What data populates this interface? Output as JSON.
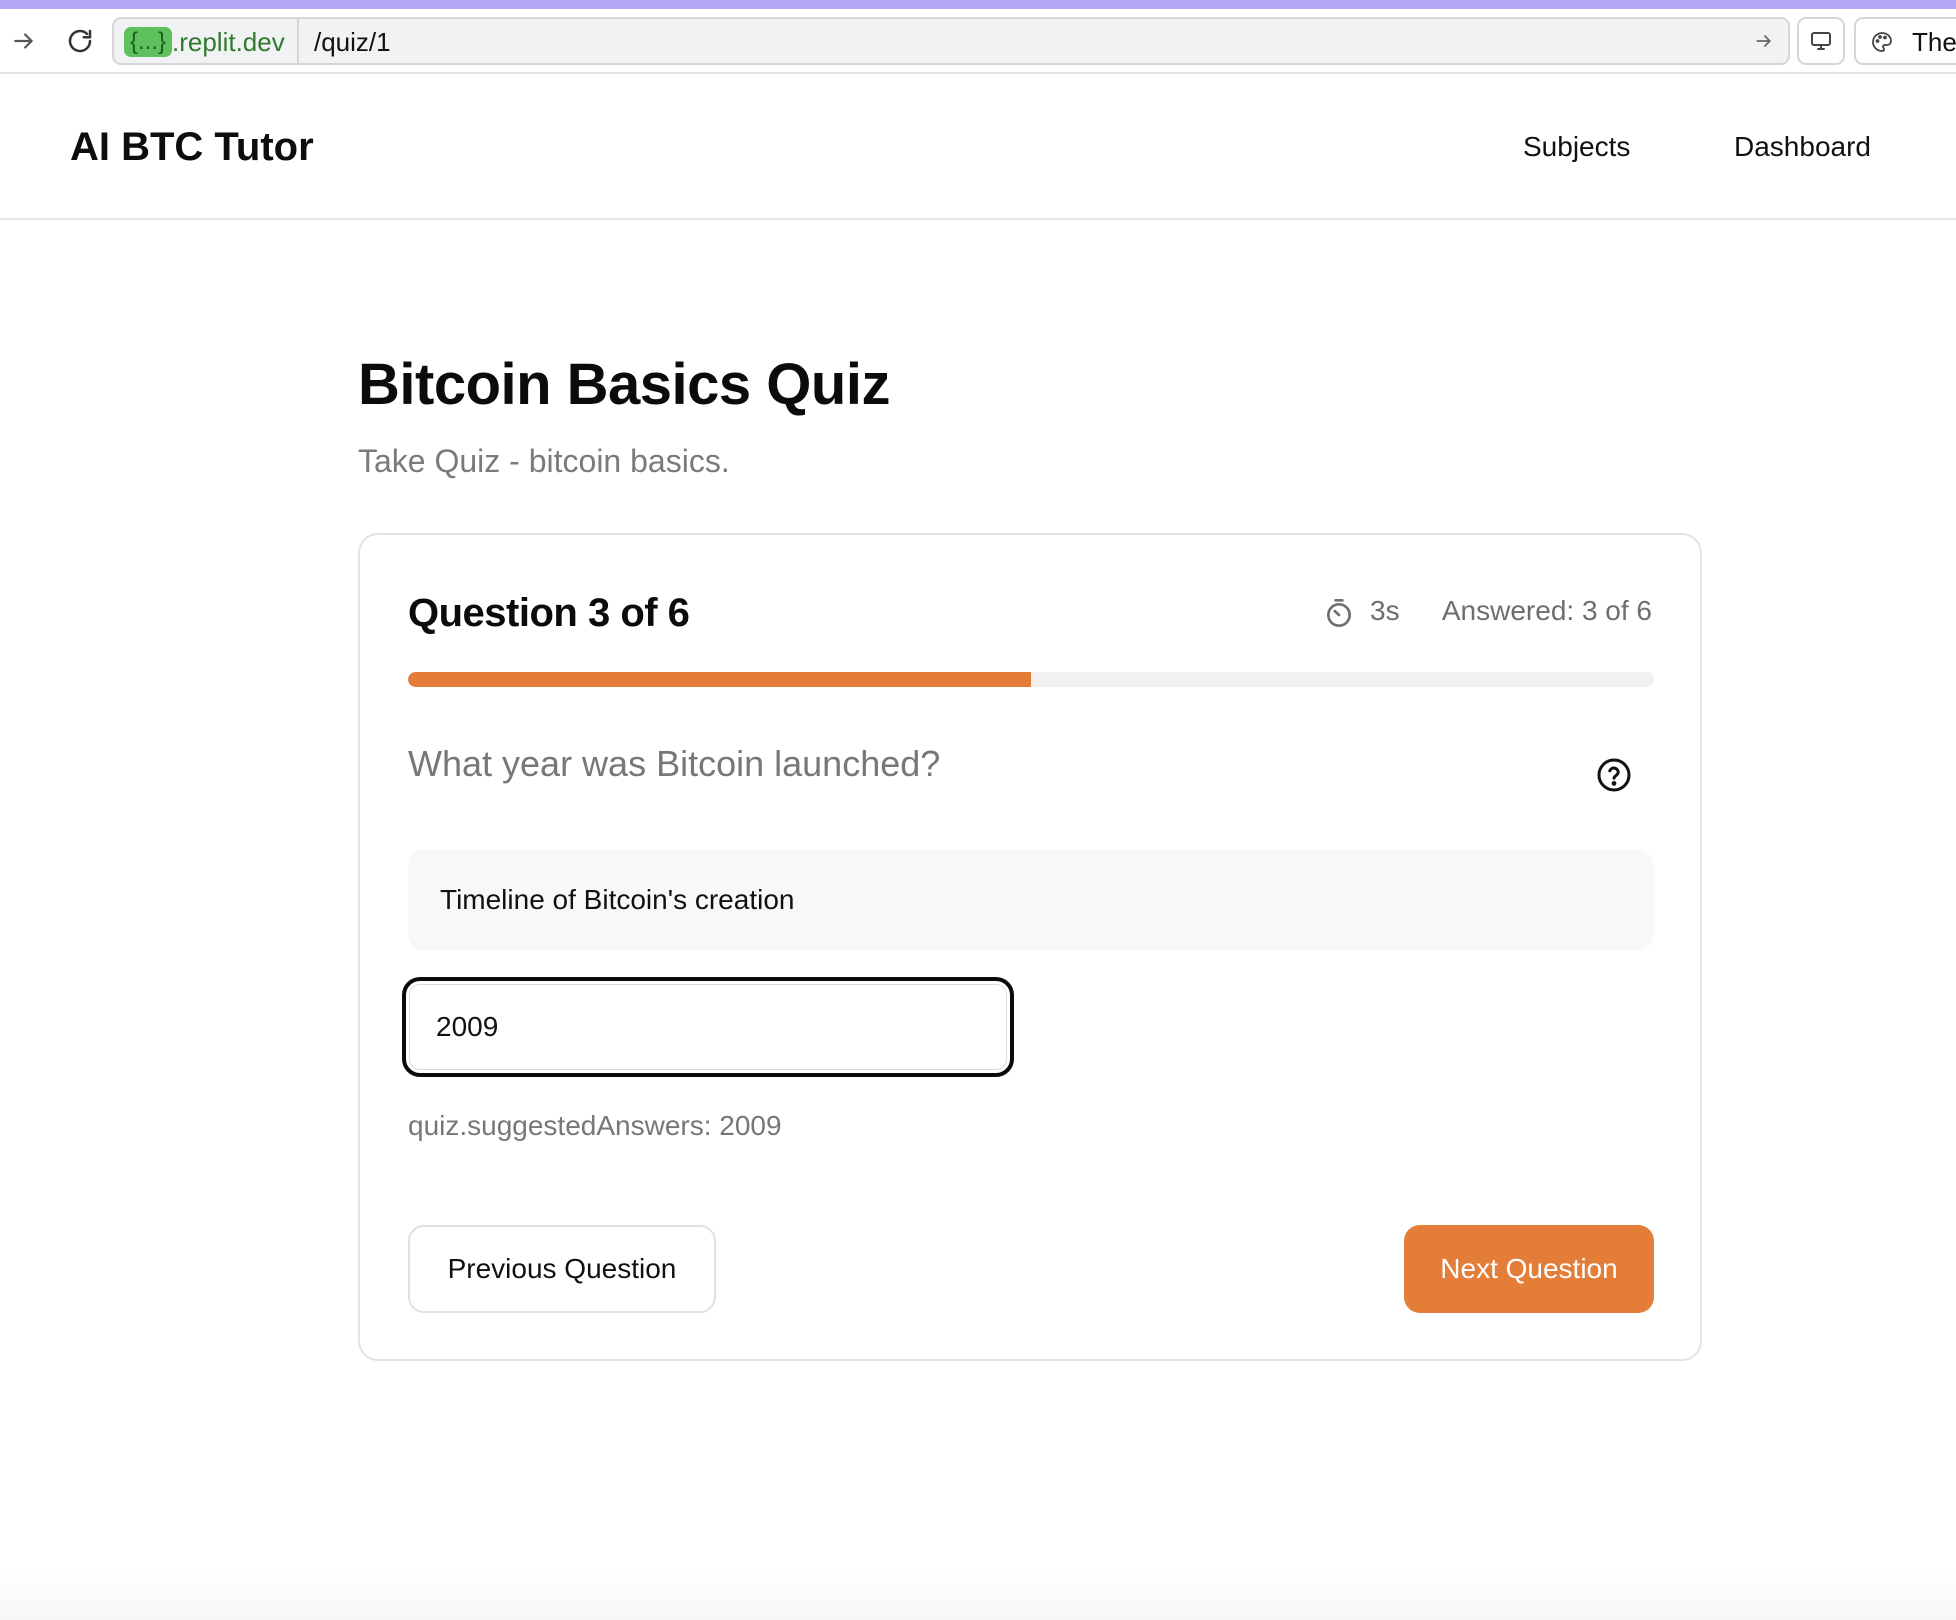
{
  "browser": {
    "url_host_badge": "{...}",
    "url_host": ".replit.dev",
    "url_path": "/quiz/1",
    "theme_label": "Ther"
  },
  "header": {
    "brand": "AI BTC Tutor",
    "nav": [
      {
        "label": "Subjects"
      },
      {
        "label": "Dashboard"
      }
    ]
  },
  "page": {
    "title": "Bitcoin Basics Quiz",
    "subtitle": "Take Quiz - bitcoin basics."
  },
  "quiz": {
    "question_heading": "Question 3 of 6",
    "timer": "3s",
    "answered": "Answered: 3 of 6",
    "progress_fraction": 0.5,
    "question": "What year was Bitcoin launched?",
    "hint": "Timeline of Bitcoin's creation",
    "answer_value": "2009",
    "suggested": "quiz.suggestedAnswers: 2009",
    "prev_label": "Previous Question",
    "next_label": "Next Question"
  },
  "icons": {
    "back": "arrow-right-icon",
    "reload": "reload-icon",
    "go": "arrow-right-icon",
    "device": "monitor-icon",
    "theme": "palette-icon",
    "timer": "stopwatch-icon",
    "help": "question-circle-icon"
  },
  "colors": {
    "accent": "#e47d37",
    "browser_strip": "#b4a6f3",
    "host_badge": "#5ec15e"
  }
}
